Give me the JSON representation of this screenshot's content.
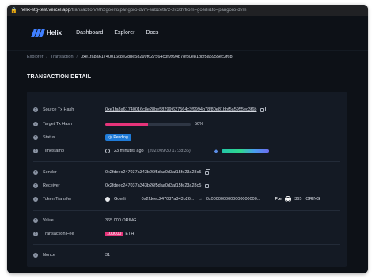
{
  "browser": {
    "url_host": "helix-stg-test.vercel.app",
    "url_path": "/transaction/eth2goerli2pangoro-dvm-sub2eth/2-0x3d?from=goerli&to=pangoro-dvm"
  },
  "nav": {
    "brand": "Helix",
    "links": [
      "Dashboard",
      "Explorer",
      "Docs"
    ]
  },
  "breadcrumb": {
    "items": [
      "Explorer",
      "Transaction"
    ],
    "current": "0xe1fa8a61740016c8e28be58299f627564c3f9994b78f80e81bbf5a5955ec3f6b"
  },
  "page_title": "TRANSACTION DETAIL",
  "detail": {
    "source_tx_hash": {
      "label": "Source Tx Hash",
      "value": "0xe1fa8a61740016c8e28be58299f627564c3f9994b78f80e81bbf5a5955ec3f6b"
    },
    "target_tx_hash": {
      "label": "Target Tx Hash",
      "progress_text": "50%",
      "progress_fraction": 0.5
    },
    "status": {
      "label": "Status",
      "value": "Pending"
    },
    "timestamp": {
      "label": "Timestamp",
      "relative": "23 minutes ago",
      "absolute": "(2022/09/30 17:38:36)"
    },
    "sender": {
      "label": "Sender",
      "value": "0x2fdeec247037a343b26f5daa0d3af15fe23a28c5"
    },
    "receiver": {
      "label": "Receiver",
      "value": "0x2fdeec247037a343b26f5daa0d3af15fe23a28c5"
    },
    "token_transfer": {
      "label": "Token Transfer",
      "network": "Goerli",
      "from_address": "0x2fdeec247037a343b26...",
      "to_address": "0x0000000000000000000...",
      "for_label": "For",
      "amount": "365",
      "token": "ORING"
    },
    "value": {
      "label": "Value",
      "value": "365.000 ORING"
    },
    "fee": {
      "label": "Transaction Fee",
      "amount": "100000",
      "unit": "ETH"
    },
    "nonce": {
      "label": "Nonce",
      "value": "31"
    }
  },
  "colors": {
    "accent_pink": "#e7347a",
    "badge_blue": "#1f7bd8",
    "brand_blue": "#3f7fff"
  }
}
